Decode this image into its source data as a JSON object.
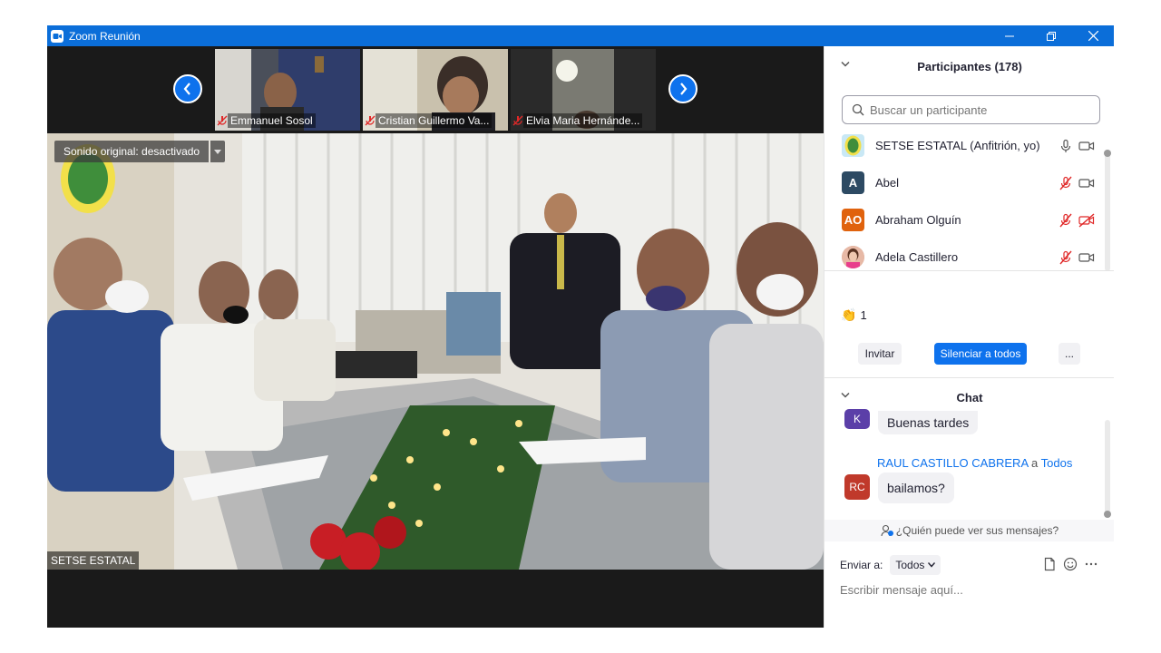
{
  "window": {
    "title": "Zoom Reunión"
  },
  "thumbnails": [
    {
      "name": "Emmanuel Sosol"
    },
    {
      "name": "Cristian Guillermo Va..."
    },
    {
      "name": "Elvia Maria Hernánde..."
    }
  ],
  "main_video": {
    "speaker_label": "SETSE ESTATAL",
    "original_sound": "Sonido original: desactivado"
  },
  "participants": {
    "header": "Participantes (178)",
    "search_placeholder": "Buscar un participante",
    "list": [
      {
        "name": "SETSE ESTATAL (Anfitrión, yo)",
        "avatar_text": "",
        "avatar_color": "#c9e8f5",
        "mic": "on",
        "video": "on"
      },
      {
        "name": "Abel",
        "avatar_text": "A",
        "avatar_color": "#2d4a63",
        "mic": "muted",
        "video": "on"
      },
      {
        "name": "Abraham Olguín",
        "avatar_text": "AO",
        "avatar_color": "#e0620d",
        "mic": "muted",
        "video": "off"
      },
      {
        "name": "Adela Castillero",
        "avatar_text": "",
        "avatar_color": "#d9a08a",
        "mic": "muted",
        "video": "on"
      }
    ],
    "reaction_count": "1",
    "invite_label": "Invitar",
    "mute_all_label": "Silenciar a todos",
    "more_label": "..."
  },
  "chat": {
    "header": "Chat",
    "messages": [
      {
        "avatar_text": "K",
        "avatar_color": "#5b3fa8",
        "text": "Buenas tardes"
      },
      {
        "sender": "RAUL CASTILLO CABRERA",
        "to_word": "a",
        "recipient": "Todos",
        "avatar_text": "RC",
        "avatar_color": "#c0392b",
        "text": "bailamos?"
      }
    ],
    "who_sees": "¿Quién puede ver sus mensajes?",
    "send_to_label": "Enviar a:",
    "send_to_value": "Todos",
    "input_placeholder": "Escribir mensaje aquí..."
  },
  "colors": {
    "accent": "#0e72ed",
    "titlebar": "#0b6ed9",
    "muted_red": "#e02828"
  }
}
